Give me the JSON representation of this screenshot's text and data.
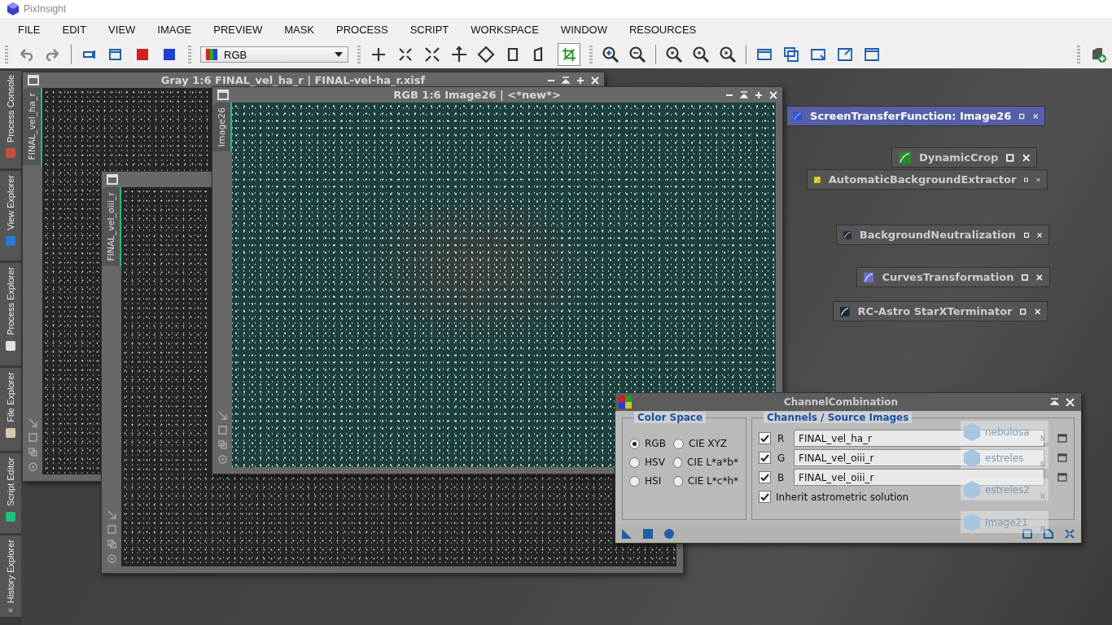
{
  "app": {
    "title": "PixInsight"
  },
  "menu": [
    "FILE",
    "EDIT",
    "VIEW",
    "IMAGE",
    "PREVIEW",
    "MASK",
    "PROCESS",
    "SCRIPT",
    "WORKSPACE",
    "WINDOW",
    "RESOURCES"
  ],
  "toolbar": {
    "color_space": "RGB"
  },
  "side_tabs": [
    {
      "label": "Process Console"
    },
    {
      "label": "View Explorer"
    },
    {
      "label": "Process Explorer"
    },
    {
      "label": "File Explorer"
    },
    {
      "label": "Script Editor"
    },
    {
      "label": "History Explorer"
    }
  ],
  "image_windows": [
    {
      "title": "Gray 1:6 FINAL_vel_ha_r | FINAL-vel-ha_r.xisf",
      "tab": "FINAL_vel_ha_r",
      "kind": "gray"
    },
    {
      "tab": "FINAL_vel_oiii_r",
      "kind": "gray"
    },
    {
      "title": "RGB 1:6 Image26 | <*new*>",
      "tab": "Image26",
      "kind": "color"
    }
  ],
  "process_icons": [
    {
      "label": "ScreenTransferFunction: Image26",
      "selected": true
    },
    {
      "label": "DynamicCrop",
      "selected": false
    },
    {
      "label": "AutomaticBackgroundExtractor",
      "selected": false
    },
    {
      "label": "BackgroundNeutralization",
      "selected": false
    },
    {
      "label": "CurvesTransformation",
      "selected": false
    },
    {
      "label": "RC-Astro StarXTerminator",
      "selected": false
    }
  ],
  "image_icons": [
    {
      "label": "nebulosa",
      "badge": "N"
    },
    {
      "label": "estreles",
      "badge": "N"
    },
    {
      "label": "estreles2",
      "badge": "N"
    },
    {
      "label": "Image21",
      "badge": "N"
    }
  ],
  "channel_combination": {
    "title": "ChannelCombination",
    "color_space": {
      "title": "Color Space",
      "options": [
        {
          "label": "RGB",
          "selected": true
        },
        {
          "label": "CIE XYZ",
          "selected": false
        },
        {
          "label": "HSV",
          "selected": false
        },
        {
          "label": "CIE L*a*b*",
          "selected": false
        },
        {
          "label": "HSI",
          "selected": false
        },
        {
          "label": "CIE L*c*h*",
          "selected": false
        }
      ]
    },
    "channels": {
      "title": "Channels / Source Images",
      "rows": [
        {
          "channel": "R",
          "checked": true,
          "image": "FINAL_vel_ha_r"
        },
        {
          "channel": "G",
          "checked": true,
          "image": "FINAL_vel_oiii_r"
        },
        {
          "channel": "B",
          "checked": true,
          "image": "FINAL_vel_oiii_r"
        }
      ],
      "inherit": {
        "label": "Inherit astrometric solution",
        "checked": true
      }
    }
  }
}
